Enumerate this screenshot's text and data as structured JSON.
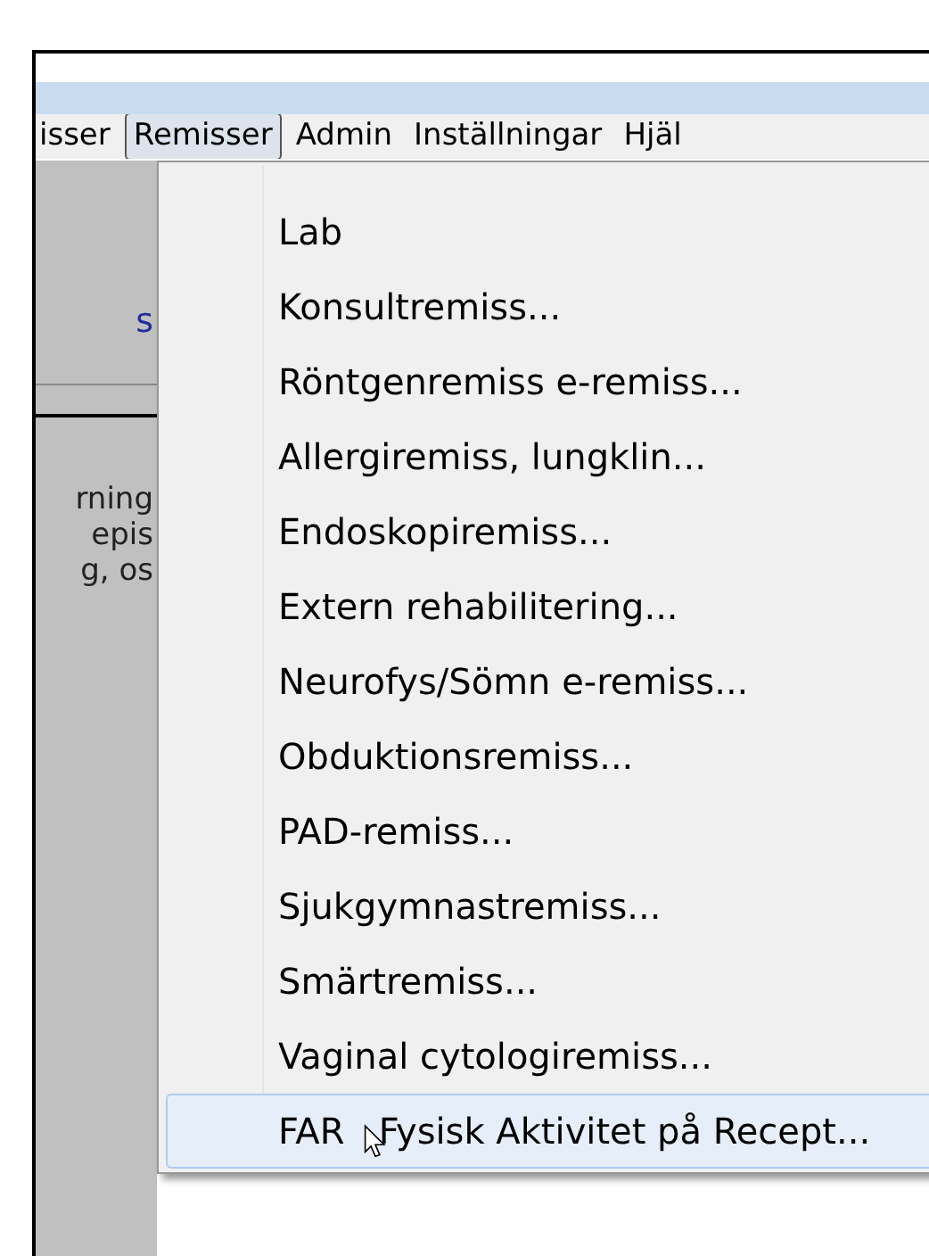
{
  "menu_bar": [
    {
      "label": "isser",
      "selected": false
    },
    {
      "label": "Remisser",
      "selected": true
    },
    {
      "label": "Admin",
      "selected": false
    },
    {
      "label": "Inställningar",
      "selected": false
    },
    {
      "label": "Hjäl",
      "selected": false
    }
  ],
  "left_panel": {
    "link": "s",
    "lines": [
      "rning",
      "epis",
      "g, os"
    ]
  },
  "dropdown": [
    {
      "label": "Lab",
      "hovered": false
    },
    {
      "label": "Konsultremiss...",
      "hovered": false
    },
    {
      "label": "Röntgenremiss e-remiss...",
      "hovered": false
    },
    {
      "label": "Allergiremiss, lungklin...",
      "hovered": false
    },
    {
      "label": "Endoskopiremiss...",
      "hovered": false
    },
    {
      "label": "Extern rehabilitering...",
      "hovered": false
    },
    {
      "label": "Neurofys/Sömn e-remiss...",
      "hovered": false
    },
    {
      "label": "Obduktionsremiss...",
      "hovered": false
    },
    {
      "label": "PAD-remiss...",
      "hovered": false
    },
    {
      "label": "Sjukgymnastremiss...",
      "hovered": false
    },
    {
      "label": "Smärtremiss...",
      "hovered": false
    },
    {
      "label": "Vaginal cytologiremiss...",
      "hovered": false
    },
    {
      "label": "FAR   Fysisk Aktivitet på Recept...",
      "hovered": true
    }
  ]
}
